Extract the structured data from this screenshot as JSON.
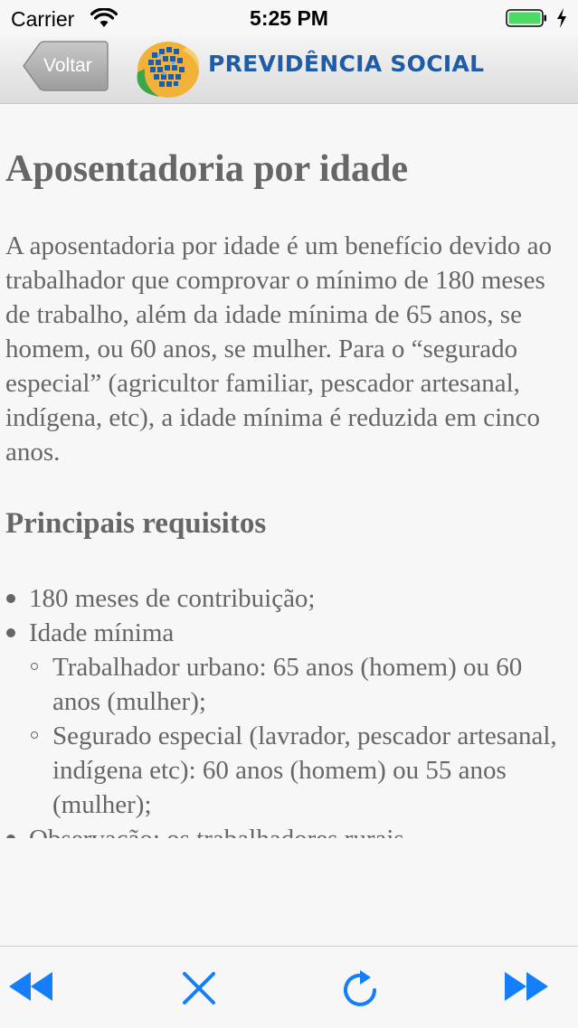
{
  "status_bar": {
    "carrier": "Carrier",
    "time": "5:25 PM",
    "battery_color": "#4cd964"
  },
  "header": {
    "back_label": "Voltar",
    "brand_name": "PREVIDÊNCIA SOCIAL",
    "brand_color": "#1f5ca8"
  },
  "content": {
    "title": "Aposentadoria por idade",
    "intro": "A aposentadoria por idade é um benefício devido ao trabalhador que comprovar o mínimo de 180 meses de trabalho, além da idade mínima de 65 anos, se homem, ou 60 anos, se mulher. Para o “segurado especial” (agricultor familiar, pescador artesanal, indígena, etc), a idade mínima é reduzida em cinco anos.",
    "requirements_heading": "Principais requisitos",
    "requirements": [
      {
        "label": "180 meses de contribuição;"
      },
      {
        "label": "Idade mínima",
        "sub": [
          "Trabalhador urbano: 65 anos (homem) ou 60 anos (mulher);",
          "Segurado especial (lavrador, pescador artesanal, indígena etc): 60 anos (homem) ou 55 anos (mulher);"
        ]
      }
    ],
    "cut_off_text": "Observação: os trabalhadores rurais"
  },
  "toolbar": {
    "icons": [
      "rewind-icon",
      "close-icon",
      "reload-icon",
      "fast-forward-icon"
    ],
    "accent_color": "#157efb"
  }
}
